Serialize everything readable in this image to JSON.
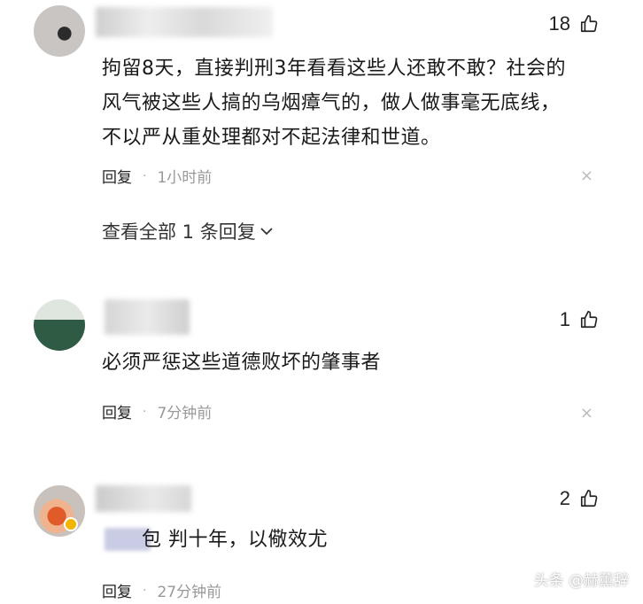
{
  "comments": [
    {
      "likes": "18",
      "text": "拘留8天，直接判刑3年看看这些人还敢不敢？社会的风气被这些人搞的乌烟瘴气的，做人做事毫无底线，不以严从重处理都对不起法律和世道。",
      "text_lines": [
        "拘留8天，直接判刑3年看看这些人还敢不敢？社会的",
        "风气被这些人搞的乌烟瘴气的，做人做事毫无底线，",
        "不以严从重处理都对不起法律和世道。"
      ],
      "reply_label": "回复",
      "time": "1小时前",
      "view_all": "查看全部 1 条回复"
    },
    {
      "likes": "1",
      "text_lines": [
        "必须严惩这些道德败坏的肇事者"
      ],
      "reply_label": "回复",
      "time": "7分钟前"
    },
    {
      "likes": "2",
      "text_lines": [
        "包 判十年，以儆效尤"
      ],
      "reply_label": "回复",
      "time": "27分钟前"
    }
  ],
  "icons": {
    "like": "thumbs-up-icon",
    "close": "close-icon",
    "expand": "chevron-down-icon"
  },
  "close_glyph": "×",
  "dot": "·",
  "watermark": "头条 @赫薰辞"
}
